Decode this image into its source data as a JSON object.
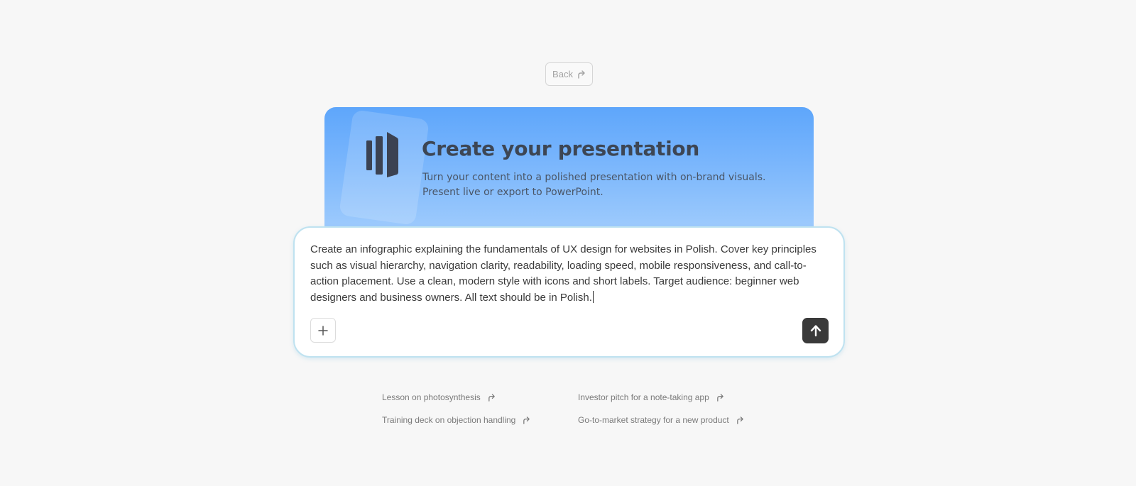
{
  "back_button": {
    "label": "Back",
    "icon": "arrow-up-right-icon"
  },
  "hero": {
    "logo_icon": "presentation-bars-icon",
    "title": "Create your presentation",
    "subtitle_line1": "Turn your content into a polished presentation with on-brand visuals.",
    "subtitle_line2": "Present live or export to PowerPoint."
  },
  "prompt": {
    "text": "Create an infographic explaining the fundamentals of UX design for websites in Polish. Cover key principles such as visual hierarchy, navigation clarity, readability, loading speed, mobile responsiveness, and call-to-action placement. Use a clean, modern style with icons and short labels. Target audience: beginner web designers and business owners. All text should be in Polish.",
    "add_icon": "plus-icon",
    "send_icon": "arrow-up-icon"
  },
  "suggestions": [
    {
      "label": "Lesson on photosynthesis",
      "icon": "arrow-up-right-icon"
    },
    {
      "label": "Investor pitch for a note-taking app",
      "icon": "arrow-up-right-icon"
    },
    {
      "label": "Training deck on objection handling",
      "icon": "arrow-up-right-icon"
    },
    {
      "label": "Go-to-market strategy for a new product",
      "icon": "arrow-up-right-icon"
    }
  ],
  "colors": {
    "page_background": "#f7f7f7",
    "hero_gradient_top": "#5ea6fb",
    "hero_gradient_bottom": "#a9d1fd",
    "send_button": "#3a3a3a",
    "prompt_border": "#bfe2f0"
  }
}
